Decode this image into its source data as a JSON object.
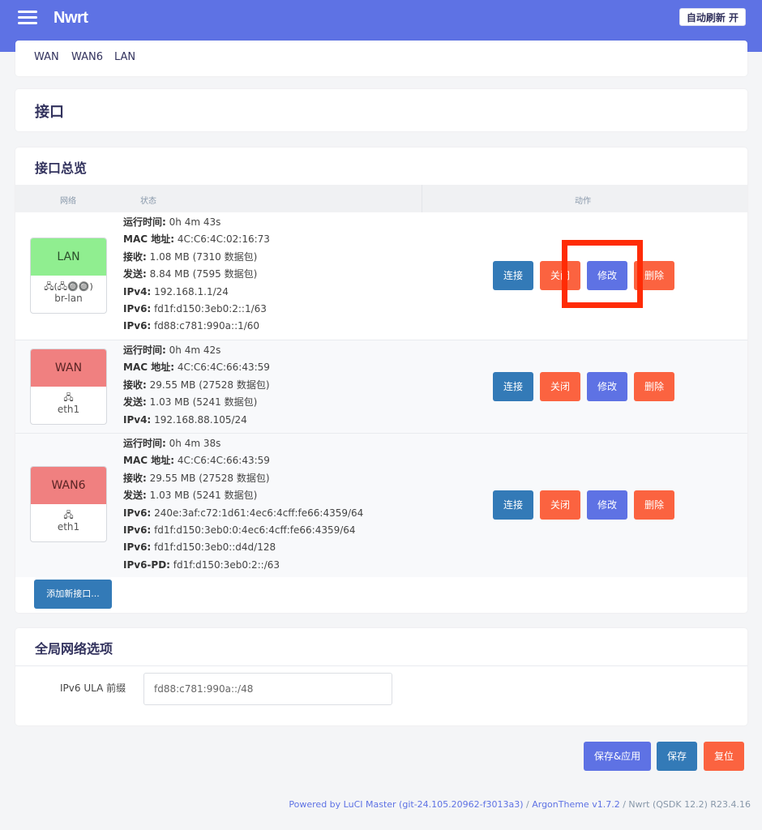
{
  "header": {
    "brand": "Nwrt",
    "auto_refresh": "自动刷新 开"
  },
  "tabs": [
    "WAN",
    "WAN6",
    "LAN"
  ],
  "page_title": "接口",
  "overview": {
    "title": "接口总览",
    "columns": {
      "network": "网络",
      "status": "状态",
      "actions": "动作"
    },
    "actions": {
      "connect": "连接",
      "close": "关闭",
      "edit": "修改",
      "delete": "删除"
    },
    "interfaces": [
      {
        "name": "LAN",
        "color": "#90ee90",
        "device_icons": "🖧(🖧🔘🔘)",
        "device": "br-lan",
        "status": [
          {
            "label": "运行时间:",
            "value": "0h 4m 43s"
          },
          {
            "label": "MAC 地址:",
            "value": "4C:C6:4C:02:16:73"
          },
          {
            "label": "接收:",
            "value": "1.08 MB (7310 数据包)"
          },
          {
            "label": "发送:",
            "value": "8.84 MB (7595 数据包)"
          },
          {
            "label": "IPv4:",
            "value": "192.168.1.1/24"
          },
          {
            "label": "IPv6:",
            "value": "fd1f:d150:3eb0:2::1/63"
          },
          {
            "label": "IPv6:",
            "value": "fd88:c781:990a::1/60"
          }
        ]
      },
      {
        "name": "WAN",
        "color": "#f08080",
        "device_icons": "🖧",
        "device": "eth1",
        "status": [
          {
            "label": "运行时间:",
            "value": "0h 4m 42s"
          },
          {
            "label": "MAC 地址:",
            "value": "4C:C6:4C:66:43:59"
          },
          {
            "label": "接收:",
            "value": "29.55 MB (27528 数据包)"
          },
          {
            "label": "发送:",
            "value": "1.03 MB (5241 数据包)"
          },
          {
            "label": "IPv4:",
            "value": "192.168.88.105/24"
          }
        ]
      },
      {
        "name": "WAN6",
        "color": "#f08080",
        "device_icons": "🖧",
        "device": "eth1",
        "status": [
          {
            "label": "运行时间:",
            "value": "0h 4m 38s"
          },
          {
            "label": "MAC 地址:",
            "value": "4C:C6:4C:66:43:59"
          },
          {
            "label": "接收:",
            "value": "29.55 MB (27528 数据包)"
          },
          {
            "label": "发送:",
            "value": "1.03 MB (5241 数据包)"
          },
          {
            "label": "IPv6:",
            "value": "240e:3af:c72:1d61:4ec6:4cff:fe66:4359/64"
          },
          {
            "label": "IPv6:",
            "value": "fd1f:d150:3eb0:0:4ec6:4cff:fe66:4359/64"
          },
          {
            "label": "IPv6:",
            "value": "fd1f:d150:3eb0::d4d/128"
          },
          {
            "label": "IPv6-PD:",
            "value": "fd1f:d150:3eb0:2::/63"
          }
        ]
      }
    ],
    "add_button": "添加新接口..."
  },
  "global": {
    "title": "全局网络选项",
    "ula_label": "IPv6 ULA 前缀",
    "ula_value": "fd88:c781:990a::/48"
  },
  "bottom_buttons": {
    "save_apply": "保存&应用",
    "save": "保存",
    "reset": "复位"
  },
  "footer": {
    "powered": "Powered by LuCI Master (git-24.105.20962-f3013a3)",
    "sep1": " / ",
    "theme": "ArgonTheme v1.7.2",
    "sep2": " / ",
    "version": "Nwrt (QSDK 12.2) R23.4.16"
  },
  "colors": {
    "accent": "#5e72e4",
    "primary": "#337ab7",
    "danger": "#fb6340",
    "highlight": "#ff2b06"
  }
}
